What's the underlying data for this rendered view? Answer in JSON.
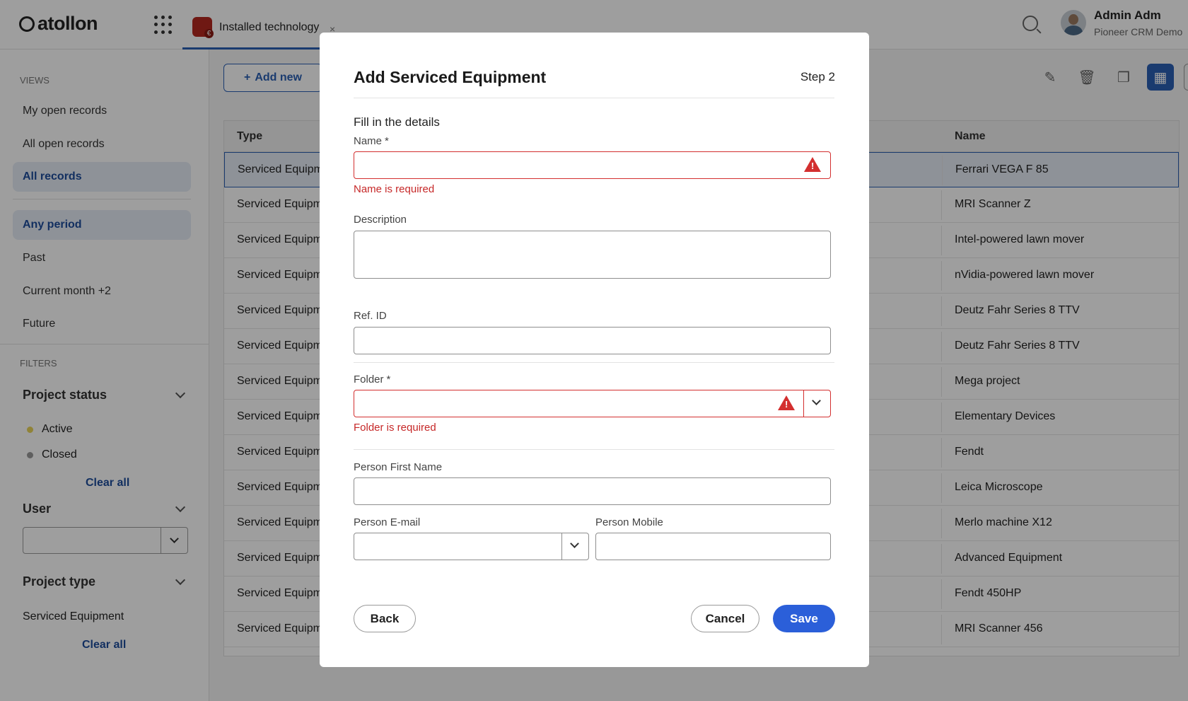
{
  "app": {
    "logo_text": "atollon",
    "tab_label": "Installed technology",
    "tab_close": "×",
    "user_name": "Admin Adm",
    "user_org": "Pioneer CRM Demo"
  },
  "sidebar": {
    "views_title": "VIEWS",
    "views": [
      "My open records",
      "All open records",
      "All records"
    ],
    "periods": [
      "Any period",
      "Past",
      "Current month +2",
      "Future"
    ],
    "filters_title": "FILTERS",
    "project_status": {
      "title": "Project status",
      "options": [
        {
          "label": "Active",
          "color": "#e8d35a"
        },
        {
          "label": "Closed",
          "color": "#9a9a9a"
        }
      ],
      "clear": "Clear all"
    },
    "user_filter": {
      "title": "User",
      "value": ""
    },
    "project_type": {
      "title": "Project type",
      "options": [
        "Serviced Equipment"
      ],
      "clear": "Clear all"
    }
  },
  "toolbar": {
    "add_new": "Add new"
  },
  "table": {
    "col_type": "Type",
    "col_name": "Name",
    "rows": [
      {
        "type": "Serviced Equipm",
        "name": "Ferrari VEGA F 85"
      },
      {
        "type": "Serviced Equipm",
        "name": "MRI Scanner Z"
      },
      {
        "type": "Serviced Equipm",
        "name": "Intel-powered lawn mover"
      },
      {
        "type": "Serviced Equipm",
        "name": "nVidia-powered lawn mover"
      },
      {
        "type": "Serviced Equipm",
        "name": "Deutz Fahr Series 8 TTV"
      },
      {
        "type": "Serviced Equipm",
        "name": "Deutz Fahr Series 8 TTV"
      },
      {
        "type": "Serviced Equipm",
        "name": "Mega project"
      },
      {
        "type": "Serviced Equipm",
        "name": "Elementary Devices"
      },
      {
        "type": "Serviced Equipm",
        "name": "Fendt"
      },
      {
        "type": "Serviced Equipm",
        "name": "Leica Microscope"
      },
      {
        "type": "Serviced Equipm",
        "name": "Merlo machine X12"
      },
      {
        "type": "Serviced Equipm",
        "name": "Advanced Equipment"
      },
      {
        "type": "Serviced Equipm",
        "name": "Fendt 450HP"
      },
      {
        "type": "Serviced Equipm",
        "name": "MRI Scanner 456"
      }
    ]
  },
  "modal": {
    "title": "Add Serviced Equipment",
    "step": "Step 2",
    "subtitle": "Fill in the details",
    "name_label": "Name",
    "name_value": "",
    "name_error": "Name is required",
    "description_label": "Description",
    "description_value": "",
    "ref_label": "Ref. ID",
    "ref_value": "",
    "folder_label": "Folder",
    "folder_value": "",
    "folder_error": "Folder is required",
    "first_name_label": "Person First Name",
    "email_label": "Person E-mail",
    "mobile_label": "Person Mobile",
    "required_mark": "*",
    "back": "Back",
    "cancel": "Cancel",
    "save": "Save"
  }
}
